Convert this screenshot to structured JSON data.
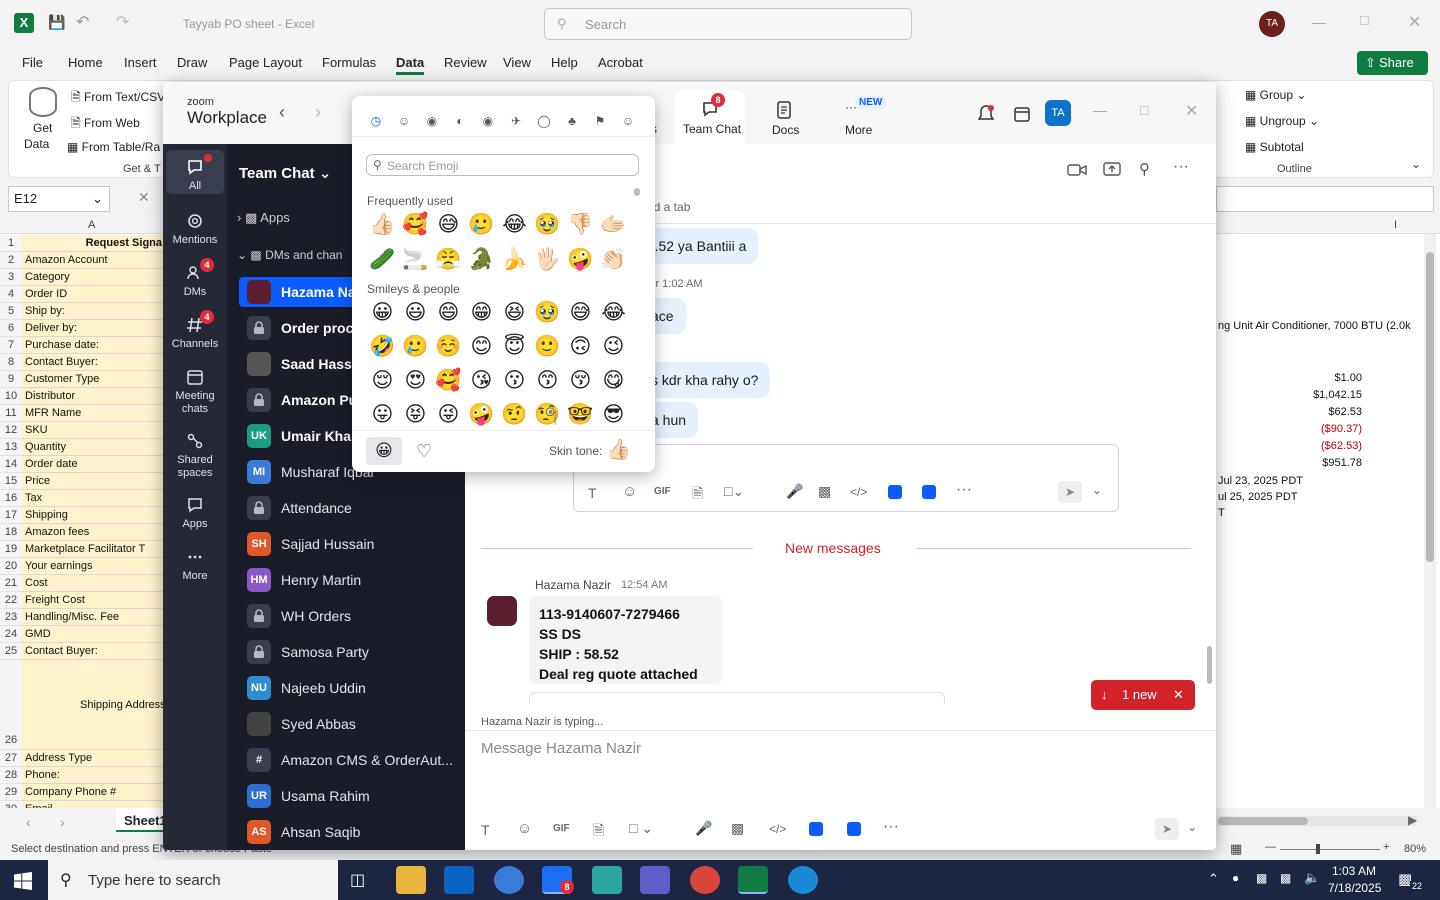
{
  "excel": {
    "title": "Tayyab PO sheet - Excel",
    "search_placeholder": "Search",
    "avatar": "TA",
    "share": "Share",
    "menu": [
      "File",
      "Home",
      "Insert",
      "Draw",
      "Page Layout",
      "Formulas",
      "Data",
      "Review",
      "View",
      "Help",
      "Acrobat"
    ],
    "active_menu": "Data",
    "ribbon": {
      "get_data": "Get",
      "get_data2": "Data",
      "from_text": "From Text/CSV",
      "from_web": "From Web",
      "from_table": "From Table/Ra",
      "group_label": "Get & T",
      "group": "Group",
      "ungroup": "Ungroup",
      "subtotal": "Subtotal",
      "outline": "Outline",
      "right_fragment": "t"
    },
    "name_box": "E12",
    "col_a": "A",
    "col_i": "I",
    "rows": [
      {
        "n": "1",
        "label": "Request Signa"
      },
      {
        "n": "2",
        "label": "Amazon Account"
      },
      {
        "n": "3",
        "label": "Category"
      },
      {
        "n": "4",
        "label": "Order ID"
      },
      {
        "n": "5",
        "label": "Ship by:"
      },
      {
        "n": "6",
        "label": "Deliver by:"
      },
      {
        "n": "7",
        "label": "Purchase date:"
      },
      {
        "n": "8",
        "label": "Contact Buyer:"
      },
      {
        "n": "9",
        "label": "Customer Type"
      },
      {
        "n": "10",
        "label": "Distributor"
      },
      {
        "n": "11",
        "label": "MFR Name"
      },
      {
        "n": "12",
        "label": "SKU"
      },
      {
        "n": "13",
        "label": "Quantity"
      },
      {
        "n": "14",
        "label": "Order date"
      },
      {
        "n": "15",
        "label": "Price"
      },
      {
        "n": "16",
        "label": "Tax"
      },
      {
        "n": "17",
        "label": "Shipping"
      },
      {
        "n": "18",
        "label": "Amazon fees"
      },
      {
        "n": "19",
        "label": "Marketplace Facilitator T"
      },
      {
        "n": "20",
        "label": "Your earnings"
      },
      {
        "n": "21",
        "label": "Cost"
      },
      {
        "n": "22",
        "label": "Freight Cost"
      },
      {
        "n": "23",
        "label": "Handling/Misc. Fee"
      },
      {
        "n": "24",
        "label": "GMD"
      },
      {
        "n": "25",
        "label": "Contact Buyer:"
      },
      {
        "n": "26",
        "label": "Shipping Address"
      },
      {
        "n": "27",
        "label": "Address Type"
      },
      {
        "n": "28",
        "label": "Phone:"
      },
      {
        "n": "29",
        "label": "Company Phone #"
      },
      {
        "n": "30",
        "label": "Email"
      }
    ],
    "right_values": {
      "product": "ng Unit Air Conditioner, 7000 BTU (2.0k",
      "v9": "$1.00",
      "v10": "$1,042.15",
      "v11": "$62.53",
      "v12": "($90.37)",
      "v13": "($62.53)",
      "v14": "$951.78",
      "d15": "Jul 23, 2025 PDT",
      "d16": "ul 25, 2025 PDT",
      "d17": "T"
    },
    "sheet_tab": "Sheet1",
    "status_text": "Select destination and press ENTER or choose Paste",
    "zoom_level": "80%"
  },
  "zoom": {
    "brand_small": "zoom",
    "brand": "Workplace",
    "tabs": {
      "team_chat": "Team Chat",
      "team_chat_badge": "8",
      "docs": "Docs",
      "more": "More",
      "new_badge": "NEW",
      "partial": "s"
    },
    "avatar": "TA",
    "rail": [
      {
        "label": "All",
        "badge": ""
      },
      {
        "label": "Mentions",
        "badge": ""
      },
      {
        "label": "DMs",
        "badge": "4"
      },
      {
        "label": "Channels",
        "badge": "4"
      },
      {
        "label": "Meeting chats",
        "badge": ""
      },
      {
        "label": "Shared spaces",
        "badge": ""
      },
      {
        "label": "Apps",
        "badge": ""
      },
      {
        "label": "More",
        "badge": ""
      }
    ],
    "list_title": "Team Chat",
    "apps_section": "Apps",
    "dms_section": "DMs and chan",
    "contacts": [
      {
        "name": "Hazama Naz",
        "initials": "",
        "color": "#5a1e2e",
        "bold": true,
        "selected": true,
        "lock": false
      },
      {
        "name": "Order proce",
        "initials": "",
        "color": "#3a3e4c",
        "bold": true,
        "selected": false,
        "lock": true
      },
      {
        "name": "Saad Hassan",
        "initials": "",
        "color": "#555",
        "bold": true,
        "selected": false,
        "lock": false
      },
      {
        "name": "Amazon Pu",
        "initials": "",
        "color": "#3a3e4c",
        "bold": true,
        "selected": false,
        "lock": true
      },
      {
        "name": "Umair Khan",
        "initials": "UK",
        "color": "#1b9c85",
        "bold": true,
        "selected": false,
        "lock": false
      },
      {
        "name": "Musharaf Iqbal",
        "initials": "MI",
        "color": "#3b7bd8",
        "bold": false,
        "selected": false,
        "lock": false
      },
      {
        "name": "Attendance",
        "initials": "",
        "color": "#3a3e4c",
        "bold": false,
        "selected": false,
        "lock": true
      },
      {
        "name": "Sajjad Hussain",
        "initials": "SH",
        "color": "#e0572a",
        "bold": false,
        "selected": false,
        "lock": false
      },
      {
        "name": "Henry Martin",
        "initials": "HM",
        "color": "#8a58c8",
        "bold": false,
        "selected": false,
        "lock": false
      },
      {
        "name": "WH Orders",
        "initials": "",
        "color": "#3a3e4c",
        "bold": false,
        "selected": false,
        "lock": true
      },
      {
        "name": "Samosa Party",
        "initials": "",
        "color": "#3a3e4c",
        "bold": false,
        "selected": false,
        "lock": true
      },
      {
        "name": "Najeeb Uddin",
        "initials": "NU",
        "color": "#2d8fd0",
        "bold": false,
        "selected": false,
        "lock": false
      },
      {
        "name": "Syed Abbas",
        "initials": "",
        "color": "#444",
        "bold": false,
        "selected": false,
        "lock": false
      },
      {
        "name": "Amazon CMS & OrderAut...",
        "initials": "#",
        "color": "#3a3e4c",
        "bold": false,
        "selected": false,
        "lock": false
      },
      {
        "name": "Usama Rahim",
        "initials": "UR",
        "color": "#2d6fd0",
        "bold": false,
        "selected": false,
        "lock": false
      },
      {
        "name": "Ahsan Saqib",
        "initials": "AS",
        "color": "#e0572a",
        "bold": false,
        "selected": false,
        "lock": false
      }
    ],
    "chat": {
      "add_tab": "ld a tab",
      "msg1": "32.52 ya Bantiii a",
      "sender_time1": "ir 1:02 AM",
      "msg2": "ace",
      "msg3": "s kdr kha rahy o?",
      "msg4": "a hun",
      "new_messages": "New messages",
      "sender": "Hazama Nazir",
      "time": "12:54 AM",
      "lines": [
        "113-9140607-7279466",
        "SS DS",
        "SHIP : 58.52",
        "Deal reg quote attached"
      ],
      "new_pill": "1 new",
      "typing": "Hazama Nazir  is typing...",
      "input_placeholder": "Message Hazama Nazir",
      "gif": "GIF"
    },
    "emoji": {
      "search_placeholder": "Search Emoji",
      "frequent": "Frequently used",
      "smileys": "Smileys & people",
      "skin_tone": "Skin tone:",
      "frequent_row1": [
        "👍🏻",
        "🥰",
        "😅",
        "🥲",
        "😂",
        "🥹",
        "👎🏻",
        "🫱🏻"
      ],
      "frequent_row2": [
        "🥒",
        "🚬",
        "😤",
        "🐊",
        "🍌",
        "🖐🏻",
        "🤪",
        "👏🏻"
      ],
      "smiley_rows": [
        [
          "😀",
          "😃",
          "😄",
          "😁",
          "😆",
          "🥹",
          "😅",
          "😂"
        ],
        [
          "🤣",
          "🥲",
          "☺️",
          "😊",
          "😇",
          "🙂",
          "🙃",
          "😉"
        ],
        [
          "😌",
          "😍",
          "🥰",
          "😘",
          "😗",
          "😙",
          "😚",
          "😋"
        ],
        [
          "😛",
          "😝",
          "😜",
          "🤪",
          "🤨",
          "🧐",
          "🤓",
          "😎"
        ]
      ]
    }
  },
  "taskbar": {
    "search_placeholder": "Type here to search",
    "time": "1:03 AM",
    "date": "7/18/2025",
    "notifications": "22",
    "zoom_badge": "8"
  }
}
